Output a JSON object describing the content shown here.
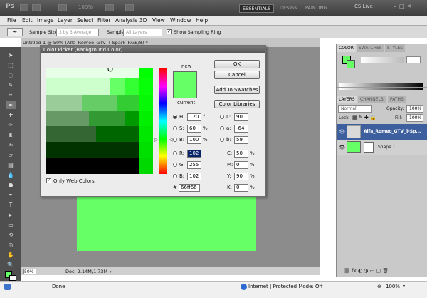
{
  "app": {
    "logo": "Ps",
    "zoom": "100%",
    "workspaces": [
      "ESSENTIALS",
      "DESIGN",
      "PAINTING"
    ],
    "cs_live": "CS Live"
  },
  "menu": [
    "File",
    "Edit",
    "Image",
    "Layer",
    "Select",
    "Filter",
    "Analysis",
    "3D",
    "View",
    "Window",
    "Help"
  ],
  "options": {
    "sample_size_label": "Sample Size:",
    "sample_size_value": "3 by 3 Average",
    "sample_label": "Sample:",
    "sample_value": "All Layers",
    "show_ring_label": "Show Sampling Ring"
  },
  "document": {
    "tab_title": "Untitled-1 @ 50% (Alfa_Romeo_GTV_T-Spark_RGB/8) *",
    "zoom": "50%",
    "doc_size": "Doc: 2.14M/1.73M",
    "fill_color": "#66ff66"
  },
  "color_picker": {
    "title": "Color Picker (Background Color)",
    "new_label": "new",
    "current_label": "current",
    "new_color": "#66ff66",
    "current_color": "#66ff66",
    "buttons": {
      "ok": "OK",
      "cancel": "Cancel",
      "add_swatches": "Add To Swatches",
      "libraries": "Color Libraries"
    },
    "only_web_colors": "Only Web Colors",
    "hsb": [
      {
        "label": "H:",
        "value": "120",
        "unit": "°",
        "selected": true
      },
      {
        "label": "S:",
        "value": "60",
        "unit": "%",
        "selected": false
      },
      {
        "label": "B:",
        "value": "100",
        "unit": "%",
        "selected": false
      }
    ],
    "rgb": [
      {
        "label": "R:",
        "value": "102",
        "unit": "",
        "selected": false
      },
      {
        "label": "G:",
        "value": "255",
        "unit": "",
        "selected": false
      },
      {
        "label": "B:",
        "value": "102",
        "unit": "",
        "selected": false
      }
    ],
    "lab": [
      {
        "label": "L:",
        "value": "90"
      },
      {
        "label": "a:",
        "value": "-64"
      },
      {
        "label": "b:",
        "value": "59"
      }
    ],
    "cmyk": [
      {
        "label": "C:",
        "value": "50",
        "unit": "%"
      },
      {
        "label": "M:",
        "value": "0",
        "unit": "%"
      },
      {
        "label": "Y:",
        "value": "90",
        "unit": "%"
      },
      {
        "label": "K:",
        "value": "0",
        "unit": "%"
      }
    ],
    "hex_label": "#",
    "hex_value": "66ff66"
  },
  "panels": {
    "color_tabs": [
      "COLOR",
      "SWATCHES",
      "STYLES"
    ],
    "layers_tabs": [
      "LAYERS",
      "CHANNELS",
      "PATHS"
    ],
    "blend_mode": "Normal",
    "opacity_label": "Opacity:",
    "opacity_value": "100%",
    "lock_label": "Lock:",
    "fill_label": "Fill:",
    "fill_value": "100%",
    "layers": [
      "Alfa_Romeo_GTV_T-Sp...",
      "Shape 1"
    ]
  },
  "taskbar": {
    "done": "Done",
    "zone": "Internet | Protected Mode: Off",
    "zoom": "100%"
  }
}
